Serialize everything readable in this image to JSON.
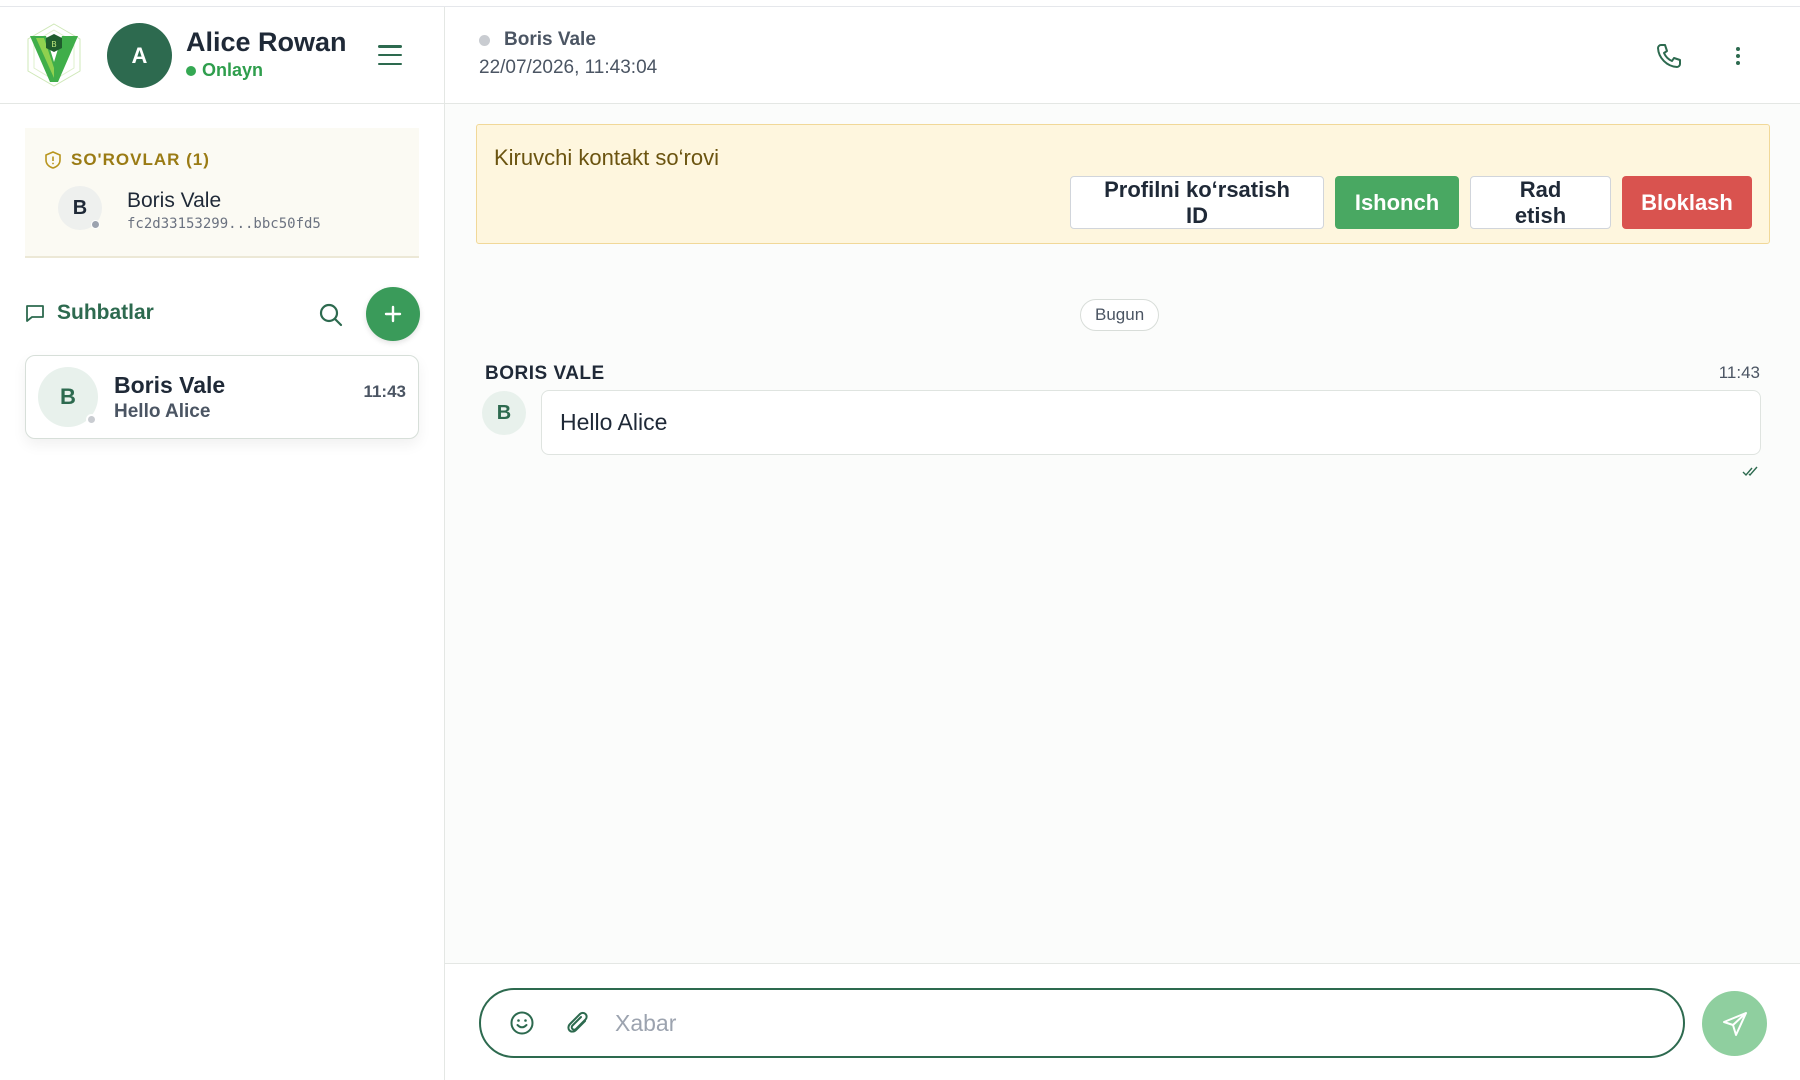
{
  "user": {
    "avatar_letter": "A",
    "name": "Alice Rowan",
    "status": "Onlayn"
  },
  "requests": {
    "title": "SO'ROVLAR (1)",
    "item": {
      "avatar_letter": "B",
      "name": "Boris Vale",
      "id": "fc2d33153299...bbc50fd5"
    }
  },
  "chats": {
    "title": "Suhbatlar",
    "items": [
      {
        "avatar_letter": "B",
        "name": "Boris Vale",
        "preview": "Hello Alice",
        "time": "11:43"
      }
    ]
  },
  "conversation": {
    "peer_name": "Boris Vale",
    "timestamp": "22/07/2026, 11:43:04"
  },
  "banner": {
    "text": "Kiruvchi kontakt so‘rovi",
    "buttons": {
      "show_profile": "Profilni ko‘rsatish ID",
      "trust": "Ishonch",
      "reject": "Rad etish",
      "block": "Bloklash"
    }
  },
  "messages": {
    "day_label": "Bugun",
    "items": [
      {
        "sender": "BORIS VALE",
        "avatar_letter": "B",
        "text": "Hello Alice",
        "time": "11:43"
      }
    ]
  },
  "composer": {
    "placeholder": "Xabar"
  },
  "colors": {
    "brand": "#2d6a4f",
    "accent_green": "#49a862",
    "danger": "#d9534f",
    "banner_bg": "#fef6de"
  },
  "icons": {
    "menu": "hamburger-icon",
    "shield": "shield-icon",
    "chat": "chat-bubble-icon",
    "search": "search-icon",
    "add": "plus-icon",
    "phone": "phone-icon",
    "more": "more-vertical-icon",
    "emoji": "emoji-icon",
    "attach": "paperclip-icon",
    "send": "send-icon",
    "read": "double-check-icon"
  }
}
